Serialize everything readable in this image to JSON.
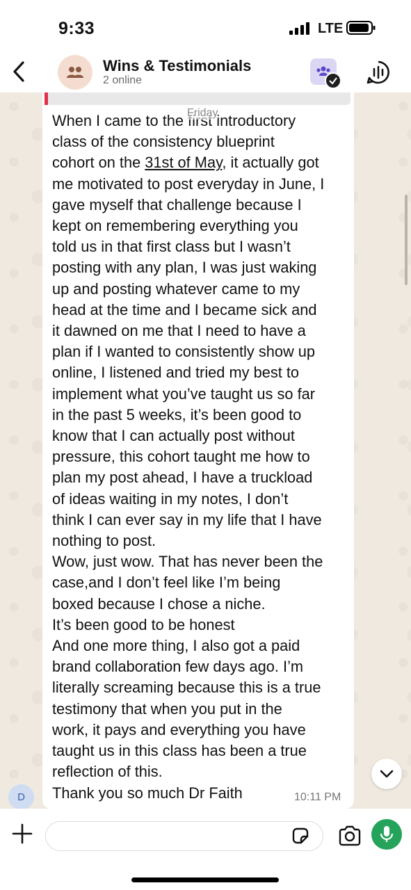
{
  "status_bar": {
    "time": "9:33",
    "network": "LTE"
  },
  "header": {
    "title": "Wins & Testimonials",
    "subtitle": "2 online",
    "icons": [
      "back-arrow-icon",
      "group-avatar-icon",
      "community-icon",
      "voice-chat-icon"
    ]
  },
  "chat": {
    "day_chip": "Friday",
    "message": {
      "sender_initial": "D",
      "time": "10:11 PM",
      "text_before_link": "When I came to the first introductory\nclass of the consistency blueprint\ncohort on the ",
      "link_text": "31st of May",
      "text_after_link": ", it actually got\nme motivated to post everyday in June, I\ngave myself that challenge because I\nkept on remembering everything you\ntold us in that first class but I wasn’t\nposting with any plan, I was just waking\nup and posting whatever came to my\nhead at the time and I became sick and\nit dawned on me that I need to have a\nplan if I wanted to consistently show up\nonline, I listened and tried my best to\nimplement what you’ve taught us so far\nin the past 5 weeks, it’s been good to\nknow that I can actually post without\npressure, this cohort taught me how to\nplan my post ahead, I have a truckload\nof ideas waiting in my notes, I don’t\nthink I can ever say in my life that I have\nnothing to post.\nWow, just wow. That has never been the\ncase,and I don’t feel like I’m being\nboxed because I chose a niche.\nIt’s been good to be honest\nAnd one more thing, I also got a paid\nbrand collaboration few days ago. I’m\nliterally screaming because this is a true\ntestimony that when you put in the\nwork, it pays and everything you have\ntaught us in this class has been a true\nreflection of this.\nThank you so much Dr Faith"
    }
  },
  "composer": {
    "placeholder": "",
    "icons": [
      "plus-icon",
      "sticker-icon",
      "camera-icon",
      "microphone-icon"
    ]
  },
  "colors": {
    "accent_green": "#25a35a",
    "quote_bar": "#e0304a",
    "wallpaper": "#efe9df"
  }
}
